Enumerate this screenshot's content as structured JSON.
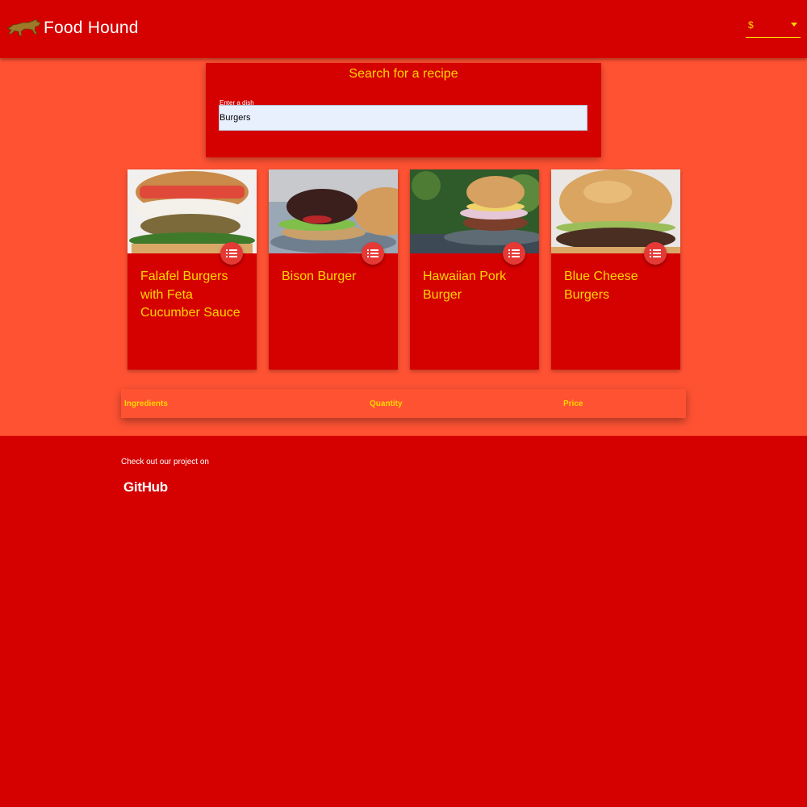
{
  "header": {
    "brand": "Food Hound",
    "logo_icon": "dog-logo-icon",
    "currency_value": "$"
  },
  "search": {
    "title": "Search for a recipe",
    "label": "Enter a dish",
    "value": "Burgers"
  },
  "recipes": [
    {
      "title": "Falafel Burgers with Feta Cucumber Sauce",
      "action_icon": "list-icon"
    },
    {
      "title": "Bison Burger",
      "action_icon": "list-icon"
    },
    {
      "title": "Hawaiian Pork Burger",
      "action_icon": "list-icon"
    },
    {
      "title": "Blue Cheese Burgers",
      "action_icon": "list-icon"
    }
  ],
  "ingredients_table": {
    "columns": [
      "Ingredients",
      "Quantity",
      "Price"
    ]
  },
  "footer": {
    "text": "Check out our project on",
    "link_label": "GitHub"
  },
  "colors": {
    "primary": "#d50000",
    "background": "#ff5233",
    "accent": "#ffd600",
    "fab": "#e53935"
  }
}
